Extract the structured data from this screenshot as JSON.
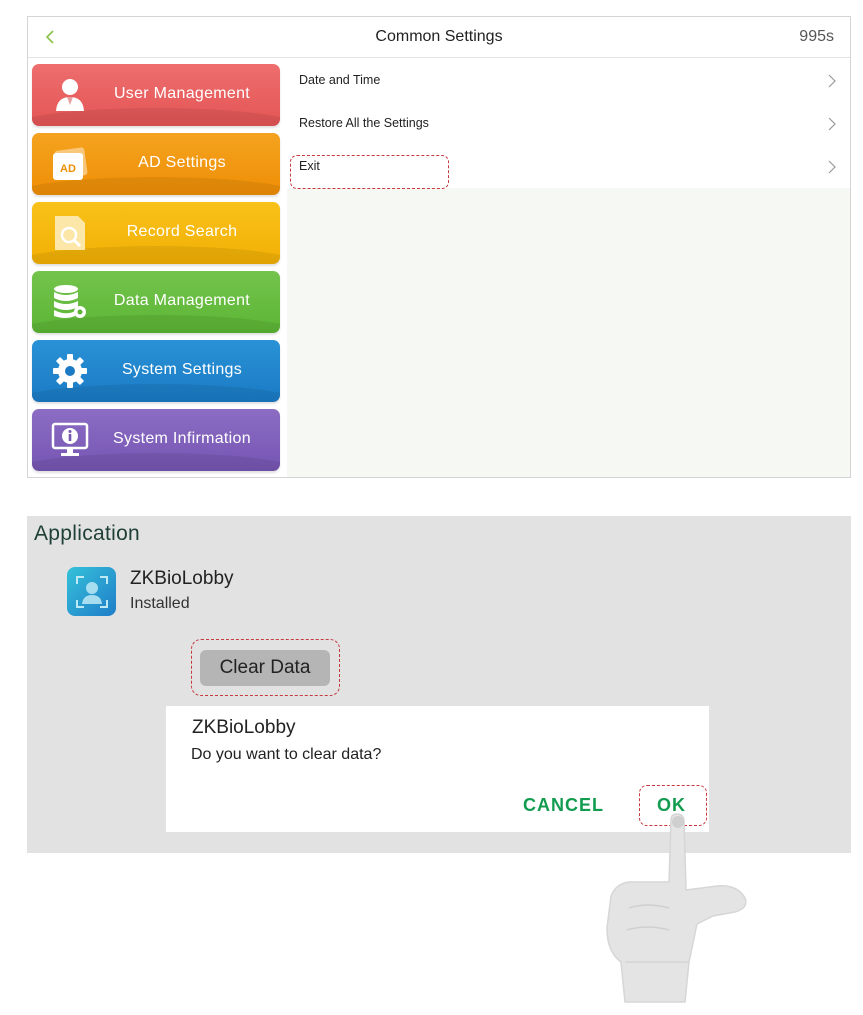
{
  "top_screen": {
    "title": "Common Settings",
    "timer": "995s",
    "sidebar": {
      "items": [
        {
          "label": "User Management",
          "icon": "user-icon",
          "color": "#e95e5e"
        },
        {
          "label": "AD Settings",
          "icon": "ad-icon",
          "icon_text": "AD",
          "color": "#f19a14"
        },
        {
          "label": "Record Search",
          "icon": "record-search-icon",
          "color": "#f5b90f"
        },
        {
          "label": "Data Management",
          "icon": "database-icon",
          "color": "#67bd40"
        },
        {
          "label": "System Settings",
          "icon": "gear-icon",
          "color": "#2286cd"
        },
        {
          "label": "System Infirmation",
          "icon": "monitor-info-icon",
          "color": "#8061bb"
        }
      ]
    },
    "settings": [
      {
        "label": "Date and Time"
      },
      {
        "label": "Restore All the Settings"
      },
      {
        "label": "Exit"
      }
    ]
  },
  "app_screen": {
    "section_title": "Application",
    "app": {
      "name": "ZKBioLobby",
      "status": "Installed",
      "icon": "zkbiolobby-app-icon"
    },
    "clear_button": "Clear Data",
    "dialog": {
      "title": "ZKBioLobby",
      "message": "Do you want to clear data?",
      "cancel": "CANCEL",
      "ok": "OK"
    }
  },
  "colors": {
    "highlight": "#c6373e",
    "dialog_button": "#129c4f",
    "panel_background": "#e2e2e2"
  }
}
